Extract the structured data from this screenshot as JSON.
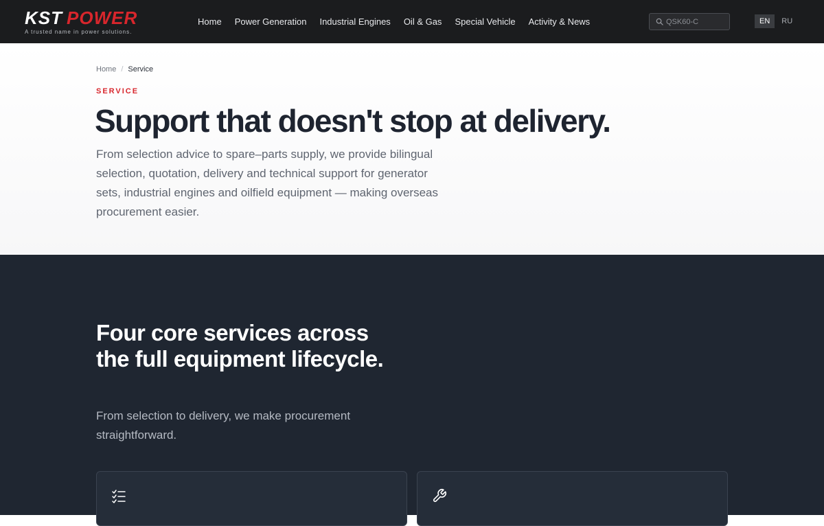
{
  "header": {
    "logo": {
      "brand_a": "KST",
      "brand_b": "POWER",
      "tagline": "A trusted name in power solutions."
    },
    "nav": [
      {
        "label": "Home"
      },
      {
        "label": "Power Generation"
      },
      {
        "label": "Industrial Engines"
      },
      {
        "label": "Oil & Gas"
      },
      {
        "label": "Special Vehicle"
      },
      {
        "label": "Activity & News"
      }
    ],
    "search": {
      "placeholder": "QSK60-C",
      "icon": "search-icon"
    },
    "languages": [
      {
        "label": "EN",
        "active": true
      },
      {
        "label": "RU",
        "active": false
      }
    ]
  },
  "hero": {
    "breadcrumb": {
      "home": "Home",
      "separator": "/",
      "current": "Service"
    },
    "eyebrow": "SERVICE",
    "title": "Support that doesn't stop at delivery.",
    "description": "From selection advice to spare–parts supply, we provide bilingual selection, quotation, delivery and technical support for generator sets, industrial engines and oilfield equipment — making overseas procurement easier."
  },
  "services": {
    "title": "Four core services across the full equipment lifecycle.",
    "description": "From selection to delivery, we make procurement straightforward.",
    "cards": [
      {
        "icon": "checklist-icon"
      },
      {
        "icon": "wrench-icon"
      }
    ]
  },
  "colors": {
    "header_bg": "#1b1c1e",
    "accent_red": "#d8262c",
    "dark_section_bg": "#1f2631",
    "card_bg": "#252d39",
    "heading_text": "#1e2430"
  }
}
